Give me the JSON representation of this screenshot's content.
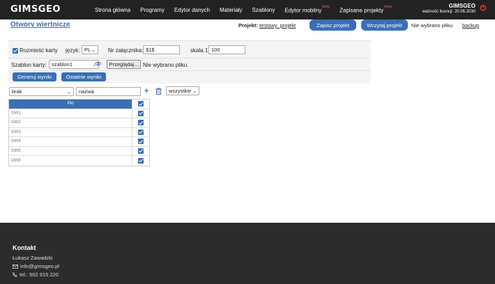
{
  "topbar": {
    "logo": "GIMSGEO",
    "nav": [
      {
        "label": "Strona główna",
        "badge": ""
      },
      {
        "label": "Programy",
        "badge": ""
      },
      {
        "label": "Edytor danych",
        "badge": ""
      },
      {
        "label": "Materiały",
        "badge": ""
      },
      {
        "label": "Szablony",
        "badge": ""
      },
      {
        "label": "Edytor mobilny",
        "badge": "beta"
      },
      {
        "label": "Zapisane projekty",
        "badge": "beta"
      }
    ],
    "account_name": "GIMSGEO",
    "license": "ważność licencji: 20.06.2030",
    "power_icon": "power-icon"
  },
  "header": {
    "title": "Otwory wiertnicze",
    "project_label": "Projekt:",
    "project_name": "testowy_projekt",
    "save_label": "Zapisz projekt",
    "load_label": "Wczytaj projekt",
    "no_file": "Nie wybrano pliku",
    "backup": "backup"
  },
  "options": {
    "place_cards_label": "Rozmieść karty",
    "place_cards_checked": true,
    "language_label": "język:",
    "language_value": "PL",
    "attachment_label": "Nr załącznika:",
    "attachment_value": "$1$",
    "scale_label": "skala 1:",
    "scale_value": "100",
    "template_label": "Szablon karty:",
    "template_value": "szablon1",
    "browse_label": "Przeglądaj...",
    "template_file": "Nie wybrano pliku.",
    "generate_label": "Generuj wyniki",
    "last_results_label": "Ostatnie wyniki"
  },
  "filter": {
    "field_value": "brak",
    "name_value": "nazwa",
    "scope_value": "wszystkie"
  },
  "table": {
    "header": "Pkt",
    "rows": [
      {
        "name": "OW1",
        "checked": true
      },
      {
        "name": "OW2",
        "checked": true
      },
      {
        "name": "OW3",
        "checked": true
      },
      {
        "name": "OW4",
        "checked": true
      },
      {
        "name": "OW5",
        "checked": true
      },
      {
        "name": "OW6",
        "checked": true
      }
    ]
  },
  "footer": {
    "title": "Kontakt",
    "person": "Łukasz Zawadzki",
    "email": "info@gimsgeo.pl",
    "phone": "tel.: 502 915 220"
  },
  "colors": {
    "accent": "#3a6fb5",
    "topbar": "#222222",
    "footer": "#2c2c2c"
  }
}
